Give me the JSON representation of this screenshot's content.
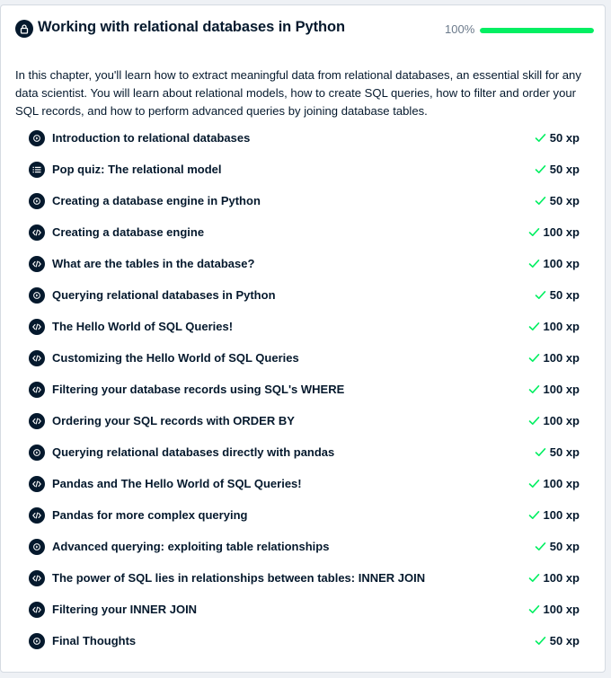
{
  "chapter": {
    "title": "Working with relational databases in Python",
    "progress_text": "100%",
    "progress_value": 1.0,
    "description": "In this chapter, you'll learn how to extract meaningful data from relational databases, an essential skill for any data scientist. You will learn about relational models, how to create SQL queries, how to filter and order your SQL records, and how to perform advanced queries by joining database tables."
  },
  "colors": {
    "accent": "#03ef62",
    "dark": "#05192d",
    "muted": "#6b7a8b"
  },
  "exercises": [
    {
      "icon": "play-icon",
      "label": "Introduction to relational databases",
      "xp": "50 xp"
    },
    {
      "icon": "list-icon",
      "label": "Pop quiz: The relational model",
      "xp": "50 xp"
    },
    {
      "icon": "play-icon",
      "label": "Creating a database engine in Python",
      "xp": "50 xp"
    },
    {
      "icon": "code-icon",
      "label": "Creating a database engine",
      "xp": "100 xp"
    },
    {
      "icon": "code-icon",
      "label": "What are the tables in the database?",
      "xp": "100 xp"
    },
    {
      "icon": "play-icon",
      "label": "Querying relational databases in Python",
      "xp": "50 xp"
    },
    {
      "icon": "code-icon",
      "label": "The Hello World of SQL Queries!",
      "xp": "100 xp"
    },
    {
      "icon": "code-icon",
      "label": "Customizing the Hello World of SQL Queries",
      "xp": "100 xp"
    },
    {
      "icon": "code-icon",
      "label": "Filtering your database records using SQL's WHERE",
      "xp": "100 xp"
    },
    {
      "icon": "code-icon",
      "label": "Ordering your SQL records with ORDER BY",
      "xp": "100 xp"
    },
    {
      "icon": "play-icon",
      "label": "Querying relational databases directly with pandas",
      "xp": "50 xp"
    },
    {
      "icon": "code-icon",
      "label": "Pandas and The Hello World of SQL Queries!",
      "xp": "100 xp"
    },
    {
      "icon": "code-icon",
      "label": "Pandas for more complex querying",
      "xp": "100 xp"
    },
    {
      "icon": "play-icon",
      "label": "Advanced querying: exploiting table relationships",
      "xp": "50 xp"
    },
    {
      "icon": "code-icon",
      "label": "The power of SQL lies in relationships between tables: INNER JOIN",
      "xp": "100 xp"
    },
    {
      "icon": "code-icon",
      "label": "Filtering your INNER JOIN",
      "xp": "100 xp"
    },
    {
      "icon": "play-icon",
      "label": "Final Thoughts",
      "xp": "50 xp"
    }
  ]
}
